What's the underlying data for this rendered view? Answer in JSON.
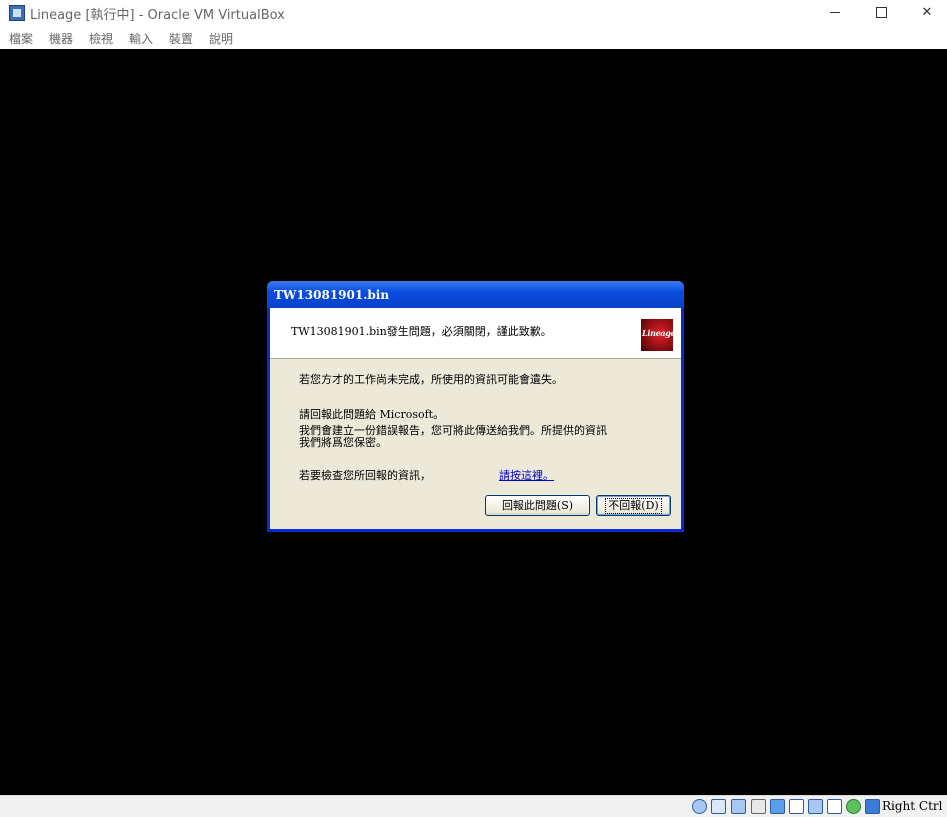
{
  "window": {
    "title": "Lineage [執行中] - Oracle VM VirtualBox",
    "controls": {
      "minimize": "minimize-icon",
      "maximize": "maximize-icon",
      "close": "✕"
    }
  },
  "menubar": {
    "items": [
      "檔案",
      "機器",
      "檢視",
      "輸入",
      "裝置",
      "說明"
    ]
  },
  "dialog": {
    "title": "TW13081901.bin",
    "header_message": "TW13081901.bin發生問題，必須關閉，謹此致歉。",
    "logo_text": "Lineage",
    "line1": "若您方才的工作尚未完成，所使用的資訊可能會遺失。",
    "line2": "請回報此問題給 Microsoft。",
    "line3": "我們會建立一份錯誤報告，您可將此傳送給我們。所提供的資訊",
    "line4": "我們將爲您保密。",
    "line5": "若要檢查您所回報的資訊，",
    "link": "請按這裡。",
    "send_button": "回報此問題(S)",
    "dont_send_button": "不回報(D)"
  },
  "statusbar": {
    "host_key": "Right Ctrl",
    "icons": [
      "hard-disk-icon",
      "optical-drive-icon",
      "audio-icon",
      "network-icon",
      "usb-icon",
      "shared-folders-icon",
      "display-icon",
      "video-capture-icon",
      "virtualization-icon",
      "mouse-integration-icon",
      "keyboard-capture-icon"
    ]
  },
  "colors": {
    "xp_title_blue": "#0a4de0",
    "xp_face": "#ece9d8",
    "vm_background": "#000000",
    "link": "#0000cc"
  }
}
